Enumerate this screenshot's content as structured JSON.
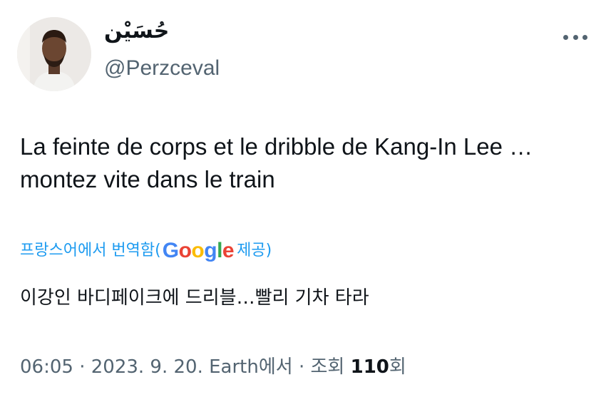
{
  "user": {
    "display_name": "حُسَيْن",
    "handle": "@Perzceval",
    "avatar_icon": "profile-photo"
  },
  "tweet": {
    "lines": [
      "La feinte de corps et le dribble de Kang-In Lee …",
      "montez vite dans le train"
    ]
  },
  "translation": {
    "label_prefix": "프랑스어에서 번역함(",
    "google_letters": [
      "G",
      "o",
      "o",
      "g",
      "l",
      "e"
    ],
    "google_colors": [
      "#4285F4",
      "#EA4335",
      "#FBBC05",
      "#4285F4",
      "#34A853",
      "#EA4335"
    ],
    "label_suffix": " 제공)",
    "text": "이강인 바디페이크에 드리블…빨리 기차 타라"
  },
  "meta": {
    "time": "06:05",
    "separator": " · ",
    "date": "2023. 9. 20.",
    "source": "Earth에서",
    "views_label": "조회 ",
    "views_count": "110",
    "views_suffix": "회"
  },
  "icons": {
    "more": "more-horizontal-icon"
  },
  "colors": {
    "link": "#1d9bf0",
    "secondary_text": "#536471",
    "primary_text": "#0f1419"
  }
}
